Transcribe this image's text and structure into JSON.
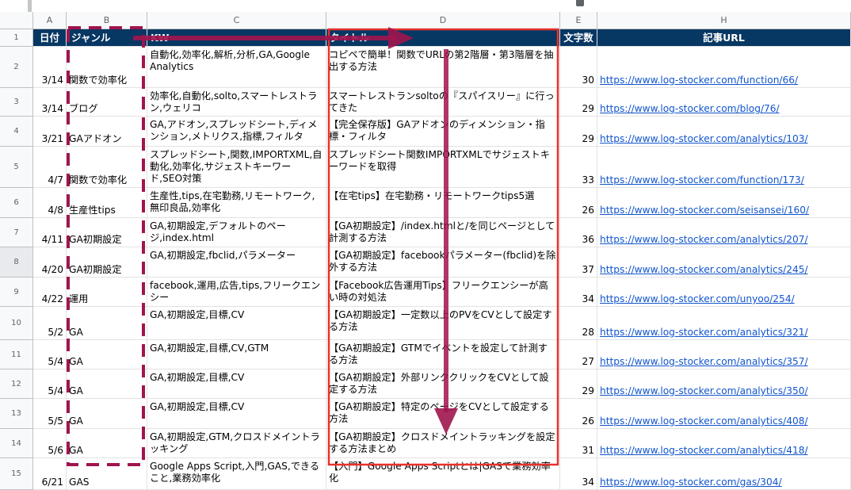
{
  "columns": [
    "A",
    "B",
    "C",
    "D",
    "E",
    "H"
  ],
  "header_row": {
    "num": "1",
    "date": "日付",
    "genre": "ジャンル",
    "kw": "KW",
    "title": "タイトル",
    "chars": "文字数",
    "url": "記事URL"
  },
  "rows": [
    {
      "num": "2",
      "date": "3/14",
      "genre": "関数で効率化",
      "kw": "自動化,効率化,解析,分析,GA,Google Analytics",
      "title": "コピペで簡単！関数でURLの第2階層・第3階層を抽出する方法",
      "chars": "30",
      "url": "https://www.log-stocker.com/function/66/"
    },
    {
      "num": "3",
      "date": "3/14",
      "genre": "ブログ",
      "kw": "効率化,自動化,solto,スマートレストラン,ウェリコ",
      "title": "スマートレストランsoltoの『スパイスリー』に行ってきた",
      "chars": "29",
      "url": "https://www.log-stocker.com/blog/76/"
    },
    {
      "num": "4",
      "date": "3/21",
      "genre": "GAアドオン",
      "kw": "GA,アドオン,スプレッドシート,ディメンション,メトリクス,指標,フィルタ",
      "title": "【完全保存版】GAアドオンのディメンション・指標・フィルタ",
      "chars": "29",
      "url": "https://www.log-stocker.com/analytics/103/"
    },
    {
      "num": "5",
      "date": "4/7",
      "genre": "関数で効率化",
      "kw": "スプレッドシート,関数,IMPORTXML,自動化,効率化,サジェストキーワード,SEO対策",
      "title": "スプレッドシート関数IMPORTXMLでサジェストキーワードを取得",
      "chars": "33",
      "url": "https://www.log-stocker.com/function/173/"
    },
    {
      "num": "6",
      "date": "4/8",
      "genre": "生産性tips",
      "kw": "生産性,tips,在宅勤務,リモートワーク,無印良品,効率化",
      "title": "【在宅tips】在宅勤務・リモートワークtips5選",
      "chars": "26",
      "url": "https://www.log-stocker.com/seisansei/160/"
    },
    {
      "num": "7",
      "date": "4/11",
      "genre": "GA初期設定",
      "kw": "GA,初期設定,デフォルトのページ,index.html",
      "title": "【GA初期設定】/index.htmlと/を同じページとして計測する方法",
      "chars": "36",
      "url": "https://www.log-stocker.com/analytics/207/"
    },
    {
      "num": "8",
      "date": "4/20",
      "genre": "GA初期設定",
      "kw": "GA,初期設定,fbclid,パラメーター",
      "title": "【GA初期設定】facebookパラメーター(fbclid)を除外する方法",
      "chars": "37",
      "url": "https://www.log-stocker.com/analytics/245/"
    },
    {
      "num": "9",
      "date": "4/22",
      "genre": "運用",
      "kw": "facebook,運用,広告,tips,フリークエンシー",
      "title": "【Facebook広告運用Tips】フリークエンシーが高い時の対処法",
      "chars": "34",
      "url": "https://www.log-stocker.com/unyoo/254/"
    },
    {
      "num": "10",
      "date": "5/2",
      "genre": "GA",
      "kw": "GA,初期設定,目標,CV",
      "title": "【GA初期設定】一定数以上のPVをCVとして設定する方法",
      "chars": "28",
      "url": "https://www.log-stocker.com/analytics/321/"
    },
    {
      "num": "11",
      "date": "5/4",
      "genre": "GA",
      "kw": "GA,初期設定,目標,CV,GTM",
      "title": "【GA初期設定】GTMでイベントを設定して計測する方法",
      "chars": "27",
      "url": "https://www.log-stocker.com/analytics/357/"
    },
    {
      "num": "12",
      "date": "5/4",
      "genre": "GA",
      "kw": "GA,初期設定,目標,CV",
      "title": "【GA初期設定】外部リンククリックをCVとして設定する方法",
      "chars": "29",
      "url": "https://www.log-stocker.com/analytics/350/"
    },
    {
      "num": "13",
      "date": "5/5",
      "genre": "GA",
      "kw": "GA,初期設定,目標,CV",
      "title": "【GA初期設定】特定のページをCVとして設定する方法",
      "chars": "26",
      "url": "https://www.log-stocker.com/analytics/408/"
    },
    {
      "num": "14",
      "date": "5/6",
      "genre": "GA",
      "kw": "GA,初期設定,GTM,クロスドメイントラッキング",
      "title": "【GA初期設定】クロスドメイントラッキングを設定する方法まとめ",
      "chars": "31",
      "url": "https://www.log-stocker.com/analytics/418/"
    },
    {
      "num": "15",
      "date": "6/21",
      "genre": "GAS",
      "kw": "Google Apps Script,入門,GAS,できること,業務効率化",
      "title": "【入門】Google Apps Scriptとは|GASで業務効率化",
      "chars": "34",
      "url": "https://www.log-stocker.com/gas/304/"
    }
  ],
  "annotation_colors": {
    "arrow": "#a0154e",
    "dashed_box": "#a0154e",
    "red_box": "#e8322c"
  }
}
